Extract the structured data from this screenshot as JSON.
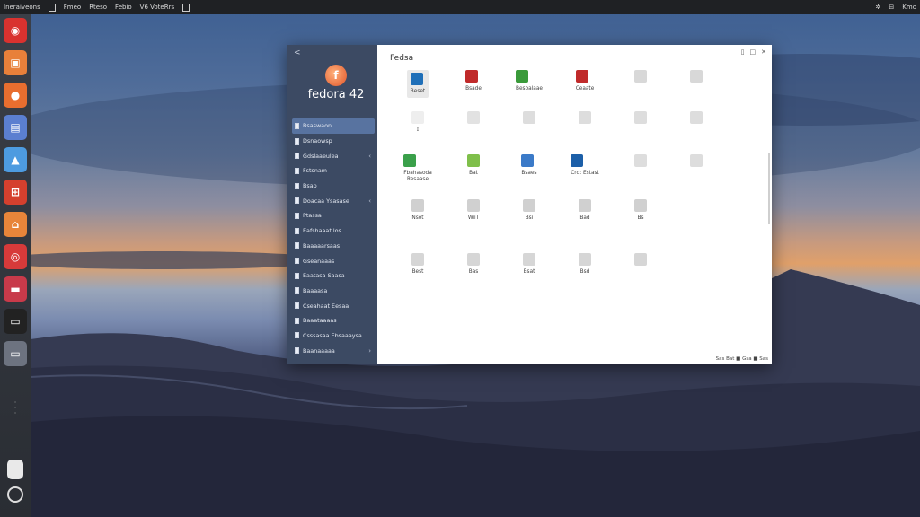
{
  "topbar": {
    "items": [
      "Ineraiveons",
      "Fmeo",
      "Rteso",
      "Febio",
      "V6 VoteRrs"
    ],
    "right": [
      "✲",
      "⊟",
      "Kmo"
    ]
  },
  "dock": {
    "icons": [
      {
        "name": "app-icon-1",
        "color": "#d9322f",
        "glyph": "◉"
      },
      {
        "name": "app-icon-2",
        "color": "#e8803a",
        "glyph": "▣"
      },
      {
        "name": "app-icon-3",
        "color": "#e86e2f",
        "glyph": "●"
      },
      {
        "name": "app-icon-4",
        "color": "#5b7fd0",
        "glyph": "▤"
      },
      {
        "name": "app-icon-5",
        "color": "#4d9be0",
        "glyph": "▲"
      },
      {
        "name": "app-icon-6",
        "color": "#d5402e",
        "glyph": "⊞"
      },
      {
        "name": "app-icon-7",
        "color": "#e8853a",
        "glyph": "⌂"
      },
      {
        "name": "app-icon-8",
        "color": "#d73a3a",
        "glyph": "◎"
      },
      {
        "name": "app-icon-9",
        "color": "#c83a4a",
        "glyph": "▬"
      },
      {
        "name": "app-icon-10",
        "color": "#222222",
        "glyph": "▭"
      },
      {
        "name": "app-icon-11",
        "color": "#6d7380",
        "glyph": "▭"
      }
    ]
  },
  "window": {
    "back_label": "<",
    "brand": "fedora 42",
    "brand_glyph": "f",
    "title": "Fedsa",
    "controls": [
      "▯",
      "□",
      "✕"
    ],
    "sidebar": [
      {
        "label": "Bsaswaon",
        "active": true,
        "chev": ""
      },
      {
        "label": "Dsnaowsp",
        "active": false,
        "chev": ""
      },
      {
        "label": "Gdslaaeulea",
        "active": false,
        "chev": "‹"
      },
      {
        "label": "Fstsnam",
        "active": false,
        "chev": ""
      },
      {
        "label": "Bsap",
        "active": false,
        "chev": ""
      },
      {
        "label": "Doacaa Ysasase",
        "active": false,
        "chev": "‹"
      },
      {
        "label": "Ptassa",
        "active": false,
        "chev": ""
      },
      {
        "label": "Eafshaaat los",
        "active": false,
        "chev": ""
      },
      {
        "label": "Baaaaarsaas",
        "active": false,
        "chev": ""
      },
      {
        "label": "Gseanaaas",
        "active": false,
        "chev": ""
      },
      {
        "label": "Eaatasa Saasa",
        "active": false,
        "chev": ""
      },
      {
        "label": "Baaaasa",
        "active": false,
        "chev": ""
      },
      {
        "label": "Cseahaat Eesaa",
        "active": false,
        "chev": ""
      },
      {
        "label": "Baaataaaas",
        "active": false,
        "chev": ""
      },
      {
        "label": "Csssasaa Ebsaaaysa",
        "active": false,
        "chev": ""
      },
      {
        "label": "Baanaaaaa",
        "active": false,
        "chev": "›"
      }
    ],
    "grid_rows": [
      [
        {
          "label": "Beset",
          "color": "#1f6fb8",
          "selected": true
        },
        {
          "label": "Bsade",
          "color": "#c02a2a",
          "selected": false
        },
        {
          "label": "Besoalaae",
          "color": "#3a9a3a",
          "selected": false
        },
        {
          "label": "Ceaate",
          "color": "#c02a2a",
          "selected": false
        },
        {
          "label": "",
          "color": "#d8d8d8",
          "selected": false
        },
        {
          "label": "",
          "color": "#d8d8d8",
          "selected": false
        }
      ],
      [
        {
          "label": "ɪ",
          "color": "#eeeeee",
          "selected": false
        },
        {
          "label": "",
          "color": "#e2e2e2",
          "selected": false
        },
        {
          "label": "",
          "color": "#dddddd",
          "selected": false
        },
        {
          "label": "",
          "color": "#dddddd",
          "selected": false
        },
        {
          "label": "",
          "color": "#dddddd",
          "selected": false
        },
        {
          "label": "",
          "color": "#dddddd",
          "selected": false
        }
      ],
      [
        {
          "label": "Fbahasoda\nResaase",
          "color": "#3aa04a",
          "selected": false
        },
        {
          "label": "Bat",
          "color": "#7fbf4a",
          "selected": false
        },
        {
          "label": "Bsaes",
          "color": "#3b7ac8",
          "selected": false
        },
        {
          "label": "Crd: Estast",
          "color": "#1c5fa8",
          "selected": false
        },
        {
          "label": "",
          "color": "#dddddd",
          "selected": false
        },
        {
          "label": "",
          "color": "#dddddd",
          "selected": false
        }
      ],
      [
        {
          "label": "Nsot",
          "color": "#d0d0d0",
          "selected": false
        },
        {
          "label": "WiiT",
          "color": "#d0d0d0",
          "selected": false
        },
        {
          "label": "Bsi",
          "color": "#d0d0d0",
          "selected": false
        },
        {
          "label": "Bad",
          "color": "#d0d0d0",
          "selected": false
        },
        {
          "label": "Bs",
          "color": "#d0d0d0",
          "selected": false
        }
      ],
      [
        {
          "label": "Best",
          "color": "#d6d6d6",
          "selected": false
        },
        {
          "label": "Bas",
          "color": "#d6d6d6",
          "selected": false
        },
        {
          "label": "Bsat",
          "color": "#d6d6d6",
          "selected": false
        },
        {
          "label": "Bsd",
          "color": "#d6d6d6",
          "selected": false
        },
        {
          "label": "",
          "color": "#d6d6d6",
          "selected": false
        }
      ]
    ],
    "status": "Sas Bat ■ Gsa ■ Sas"
  }
}
